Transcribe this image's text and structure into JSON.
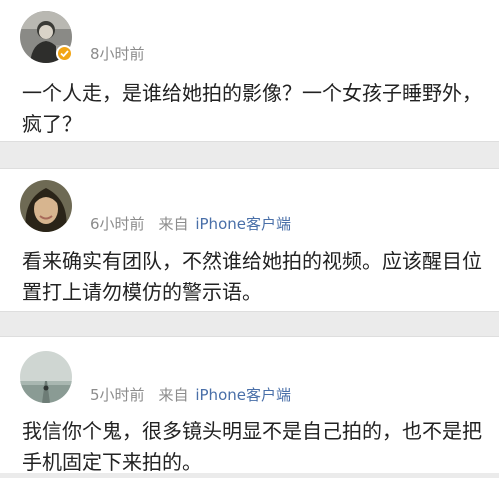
{
  "comments": [
    {
      "time": "8小时前",
      "text": "一个人走，是谁给她拍的影像？一个女孩子睡野外，疯了？",
      "verified": true
    },
    {
      "time": "6小时前",
      "source_prefix": "来自",
      "client": "iPhone客户端",
      "text": "看来确实有团队，不然谁给她拍的视频。应该醒目位置打上请勿模仿的警示语。"
    },
    {
      "time": "5小时前",
      "source_prefix": "来自",
      "client": "iPhone客户端",
      "text": "我信你个鬼，很多镜头明显不是自己拍的，也不是把手机固定下来拍的。"
    }
  ],
  "colors": {
    "background": "#ebebeb",
    "card": "#ffffff",
    "meta_text": "#8c8c8c",
    "client_link": "#496fa8",
    "verified_badge": "#f2a516"
  }
}
